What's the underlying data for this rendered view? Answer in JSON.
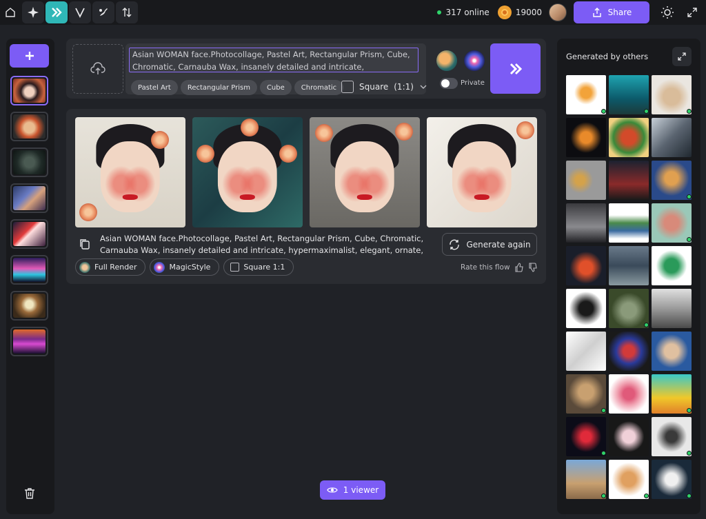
{
  "topbar": {
    "online_text": "317 online",
    "credits": "19000",
    "share_label": "Share",
    "nav": [
      {
        "name": "home-icon"
      },
      {
        "name": "sparkle-icon"
      },
      {
        "name": "flow-icon",
        "active": true
      },
      {
        "name": "v-icon"
      },
      {
        "name": "brush-icon"
      },
      {
        "name": "swap-icon"
      }
    ]
  },
  "prompt": {
    "text": "Asian WOMAN face.Photocollage, Pastel Art, Rectangular Prism, Cube, Chromatic, Carnauba Wax, insanely detailed and intricate,",
    "chips": [
      "Pastel Art",
      "Rectangular Prism",
      "Cube",
      "Chromatic"
    ],
    "aspect_label": "Square",
    "aspect_ratio": "(1:1)",
    "private_label": "Private",
    "private_on": false
  },
  "result": {
    "description": "Asian WOMAN face.Photocollage, Pastel Art, Rectangular Prism, Cube, Chromatic, Carnauba Wax, insanely detailed and intricate, hypermaximalist, elegant, ornate, hyper…",
    "regenerate_label": "Generate again",
    "tags": [
      "Full Render",
      "MagicStyle",
      "Square 1:1"
    ],
    "rate_label": "Rate this flow"
  },
  "viewer_label": "1 viewer",
  "gallery": {
    "title": "Generated by others"
  },
  "colors": {
    "accent": "#7c5cf5",
    "active_nav": "#2fb7b7",
    "online": "#2fd36a",
    "panel": "#2a2c31",
    "background": "#202227"
  }
}
